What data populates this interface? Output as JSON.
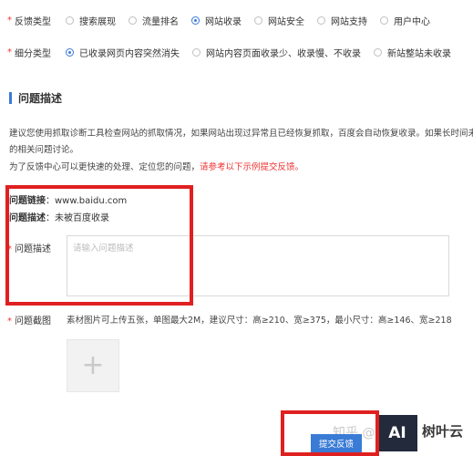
{
  "feedback_type": {
    "label": "反馈类型",
    "options": [
      "搜索展现",
      "流量排名",
      "网站收录",
      "网站安全",
      "网站支持",
      "用户中心"
    ],
    "selected": "网站收录"
  },
  "sub_type": {
    "label": "细分类型",
    "options": [
      "已收录网页内容突然消失",
      "网站内容页面收录少、收录慢、不收录",
      "新站整站未收录"
    ],
    "selected": "已收录网页内容突然消失"
  },
  "section": {
    "title": "问题描述"
  },
  "intro": {
    "line1": "建议您使用抓取诊断工具检查网站的抓取情况，如果网站出现过异常且已经恢复抓取，百度会自动恢复收录。如果长时间未恢",
    "line2": "的相关问题讨论。",
    "line3_prefix": "为了反馈中心可以更快速的处理、定位您的问题，",
    "line3_red": "请参考以下示例提交反馈。"
  },
  "example": {
    "link_label": "问题链接",
    "link_value": "www.baidu.com",
    "desc_label": "问题描述",
    "desc_value": "未被百度收录"
  },
  "description_field": {
    "label": "问题描述",
    "placeholder": "请输入问题描述",
    "value": ""
  },
  "screenshot_field": {
    "label": "问题截图",
    "note": "素材图片可上传五张，单图最大2M，建议尺寸：高≥210、宽≥375，最小尺寸：高≥146、宽≥218",
    "add_glyph": "+"
  },
  "submit": {
    "label": "提交反馈"
  },
  "watermark": {
    "zhihu": "知乎 @",
    "logo_text": "AI",
    "brand": "树叶云"
  },
  "colors": {
    "accent": "#3a7bd5",
    "required": "#e33333",
    "annotation": "#e02020"
  }
}
